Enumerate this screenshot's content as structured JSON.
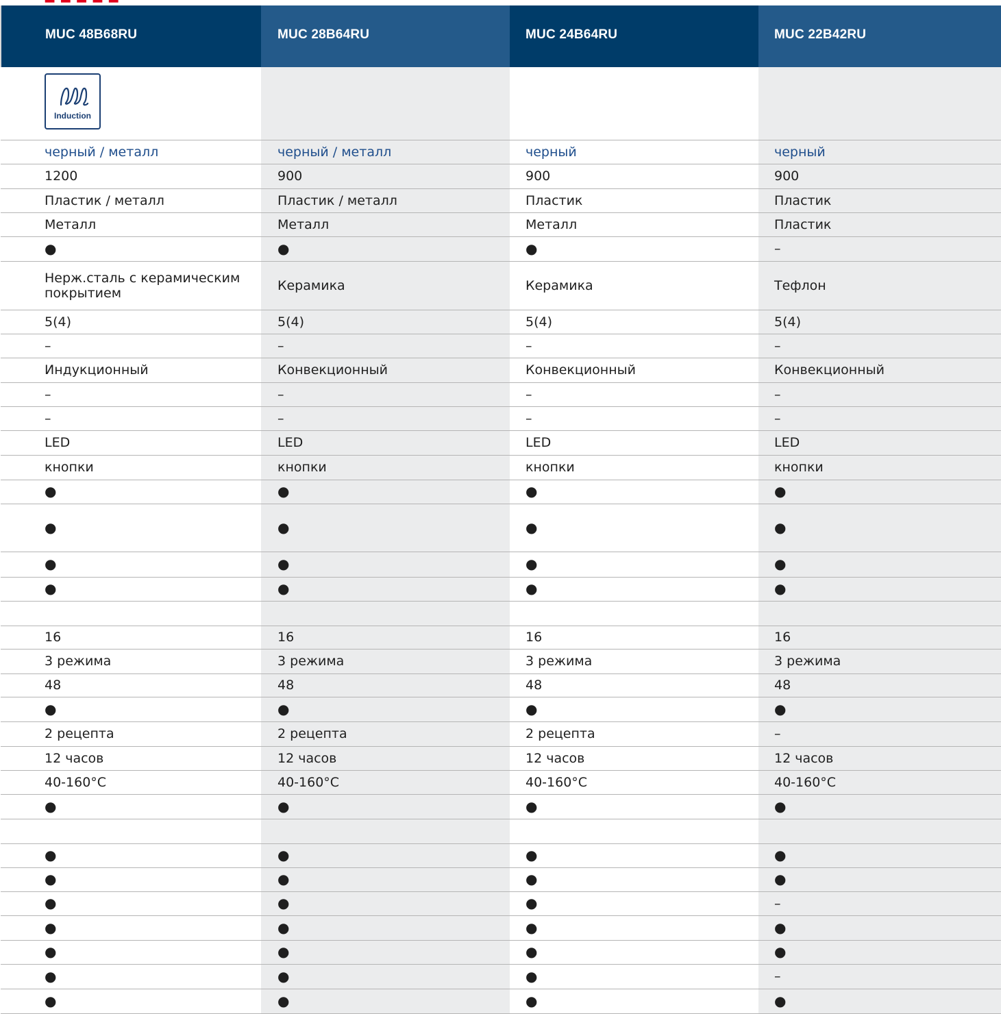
{
  "models": [
    "MUC 48B68RU",
    "MUC 28B64RU",
    "MUC 24B64RU",
    "MUC 22B42RU"
  ],
  "icon": {
    "name": "induction-icon",
    "caption": "Induction"
  },
  "rows": [
    [
      "черный / металл",
      "черный / металл",
      "черный",
      "черный"
    ],
    [
      "1200",
      "900",
      "900",
      "900"
    ],
    [
      "Пластик / металл",
      "Пластик / металл",
      "Пластик",
      "Пластик"
    ],
    [
      "Металл",
      "Металл",
      "Металл",
      "Пластик"
    ],
    [
      "●",
      "●",
      "●",
      "–"
    ],
    [
      "Нерж.сталь с керамическим покрытием",
      "Керамика",
      "Керамика",
      "Тефлон"
    ],
    [
      "5(4)",
      "5(4)",
      "5(4)",
      "5(4)"
    ],
    [
      "–",
      "–",
      "–",
      "–"
    ],
    [
      "Индукционный",
      "Конвекционный",
      "Конвекционный",
      "Конвекционный"
    ],
    [
      "–",
      "–",
      "–",
      "–"
    ],
    [
      "–",
      "–",
      "–",
      "–"
    ],
    [
      "LED",
      "LED",
      "LED",
      "LED"
    ],
    [
      "кнопки",
      "кнопки",
      "кнопки",
      "кнопки"
    ],
    [
      "●",
      "●",
      "●",
      "●"
    ],
    [
      "●",
      "●",
      "●",
      "●"
    ],
    [
      "●",
      "●",
      "●",
      "●"
    ],
    [
      "●",
      "●",
      "●",
      "●"
    ],
    [
      "",
      "",
      "",
      ""
    ],
    [
      "16",
      "16",
      "16",
      "16"
    ],
    [
      "3 режима",
      "3 режима",
      "3 режима",
      "3 режима"
    ],
    [
      "48",
      "48",
      "48",
      "48"
    ],
    [
      "●",
      "●",
      "●",
      "●"
    ],
    [
      "2 рецепта",
      "2 рецепта",
      "2 рецепта",
      "–"
    ],
    [
      "12 часов",
      "12 часов",
      "12 часов",
      "12 часов"
    ],
    [
      "40-160°C",
      "40-160°C",
      "40-160°C",
      "40-160°C"
    ],
    [
      "●",
      "●",
      "●",
      "●"
    ],
    [
      "",
      "",
      "",
      ""
    ],
    [
      "●",
      "●",
      "●",
      "●"
    ],
    [
      "●",
      "●",
      "●",
      "●"
    ],
    [
      "●",
      "●",
      "●",
      "–"
    ],
    [
      "●",
      "●",
      "●",
      "●"
    ],
    [
      "●",
      "●",
      "●",
      "●"
    ],
    [
      "●",
      "●",
      "●",
      "–"
    ],
    [
      "●",
      "●",
      "●",
      "●"
    ]
  ],
  "colors": {
    "header_dark": "#003c69",
    "header_light": "#245a8a",
    "stripe": "#ebeced",
    "accent_text": "#1f4e8c"
  }
}
